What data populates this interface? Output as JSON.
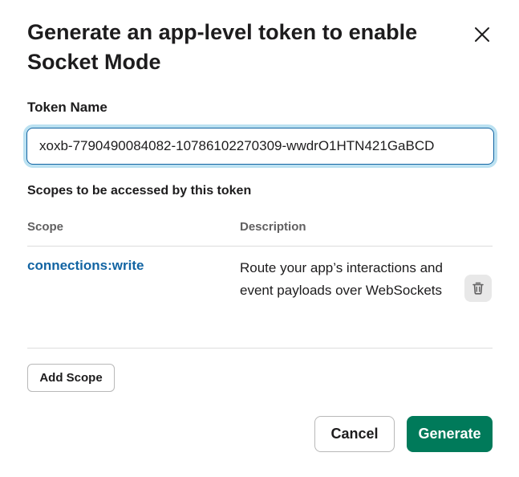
{
  "modal": {
    "title": "Generate an app-level token to enable Socket Mode",
    "close_icon": "close-icon"
  },
  "token_field": {
    "label": "Token Name",
    "value": "xoxb-7790490084082-10786102270309-wwdrO1HTN421GaBCD"
  },
  "scopes": {
    "section_label": "Scopes to be accessed by this token",
    "columns": [
      "Scope",
      "Description"
    ],
    "rows": [
      {
        "scope": "connections:write",
        "description": "Route your app’s interactions and event payloads over WebSockets",
        "remove_icon": "trash-icon"
      }
    ],
    "add_label": "Add Scope"
  },
  "footer": {
    "cancel_label": "Cancel",
    "generate_label": "Generate"
  },
  "colors": {
    "link": "#1264a3",
    "primary": "#007a5a",
    "focus_ring": "#1d9bd1"
  }
}
